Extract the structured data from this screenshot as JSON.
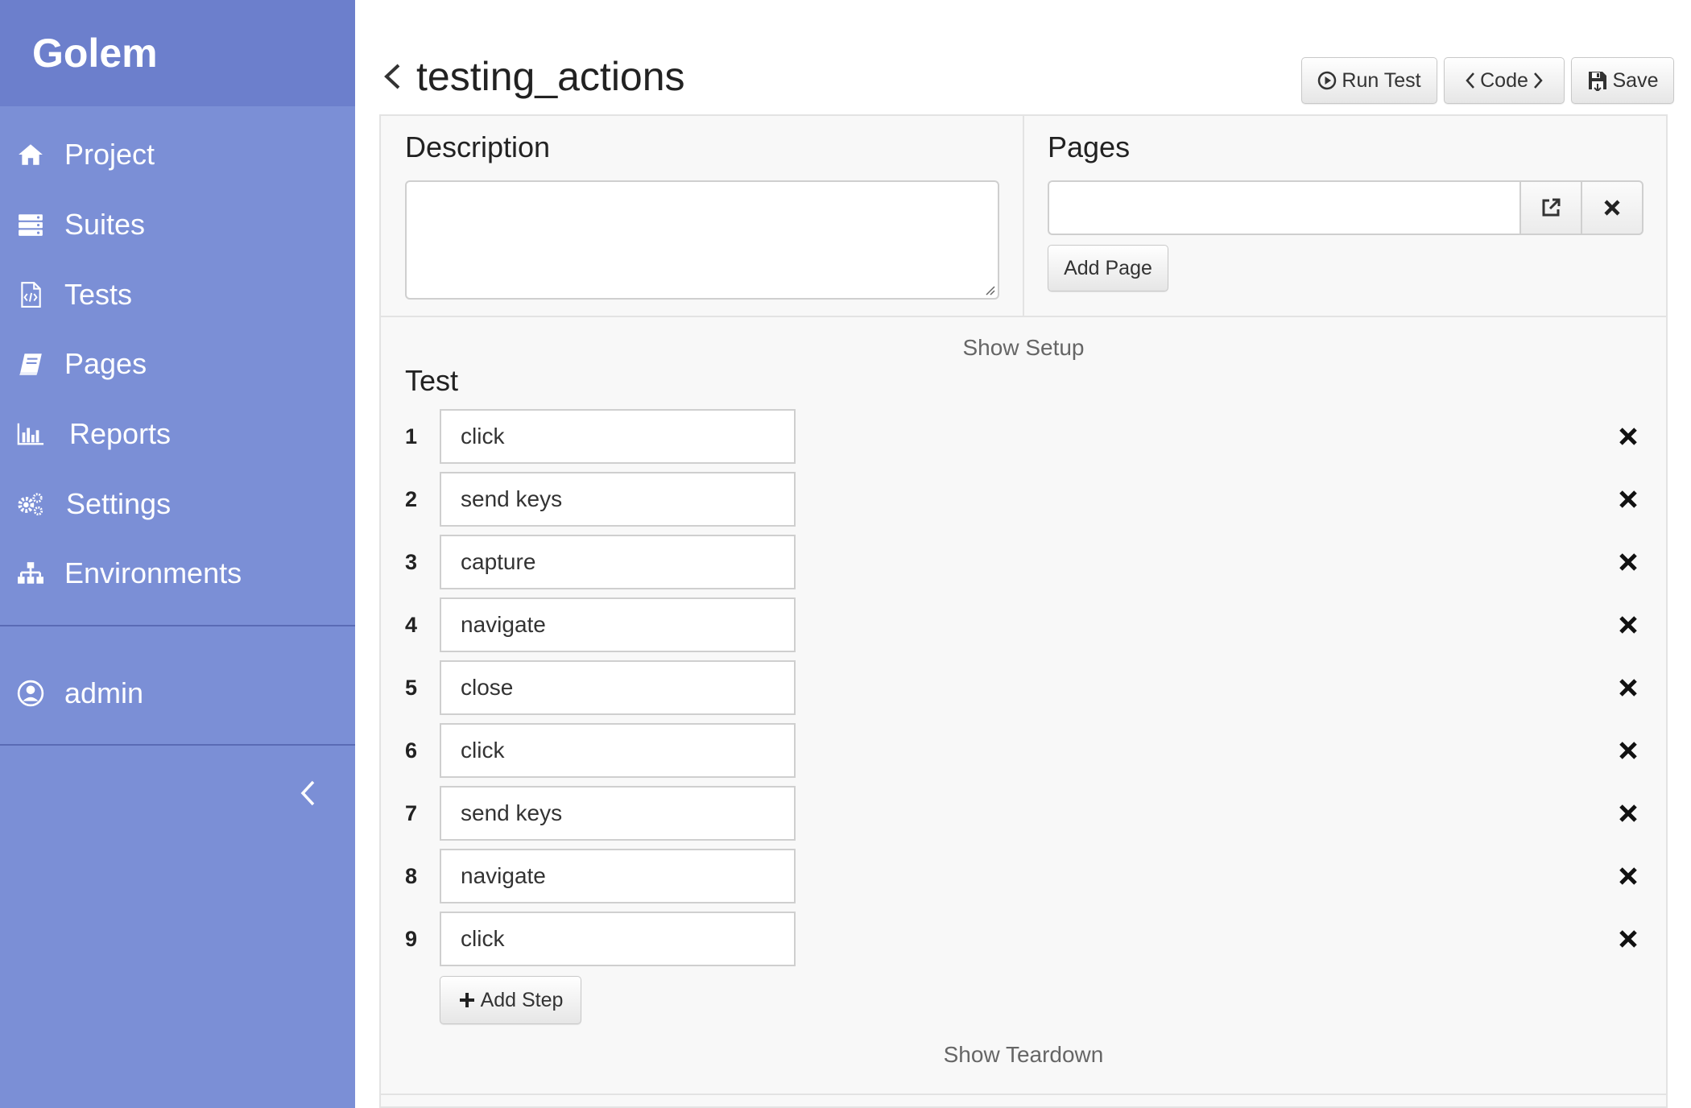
{
  "sidebar": {
    "brand": "Golem",
    "nav": [
      {
        "label": "Project",
        "icon": "home-icon"
      },
      {
        "label": "Suites",
        "icon": "suites-icon"
      },
      {
        "label": "Tests",
        "icon": "file-code-icon"
      },
      {
        "label": "Pages",
        "icon": "book-icon"
      },
      {
        "label": "Reports",
        "icon": "bar-chart-icon"
      },
      {
        "label": "Settings",
        "icon": "gears-icon"
      },
      {
        "label": "Environments",
        "icon": "sitemap-icon"
      }
    ],
    "user": {
      "label": "admin",
      "icon": "user-circle-icon"
    },
    "collapse_icon": "chevron-left-icon"
  },
  "header": {
    "title": "testing_actions",
    "back_icon": "chevron-left-icon",
    "buttons": {
      "run": "Run Test",
      "code": "Code",
      "save": "Save"
    }
  },
  "description": {
    "title": "Description",
    "value": ""
  },
  "pages": {
    "title": "Pages",
    "input_value": "",
    "add_label": "Add Page"
  },
  "test": {
    "show_setup": "Show Setup",
    "title": "Test",
    "steps": [
      {
        "num": "1",
        "action": "click"
      },
      {
        "num": "2",
        "action": "send keys"
      },
      {
        "num": "3",
        "action": "capture"
      },
      {
        "num": "4",
        "action": "navigate"
      },
      {
        "num": "5",
        "action": "close"
      },
      {
        "num": "6",
        "action": "click"
      },
      {
        "num": "7",
        "action": "send keys"
      },
      {
        "num": "8",
        "action": "navigate"
      },
      {
        "num": "9",
        "action": "click"
      }
    ],
    "add_step": "Add Step",
    "show_teardown": "Show Teardown"
  },
  "colors": {
    "sidebar": "#7b8fd6",
    "brand_bar": "#6c7fcc",
    "panel": "#f8f8f8"
  }
}
